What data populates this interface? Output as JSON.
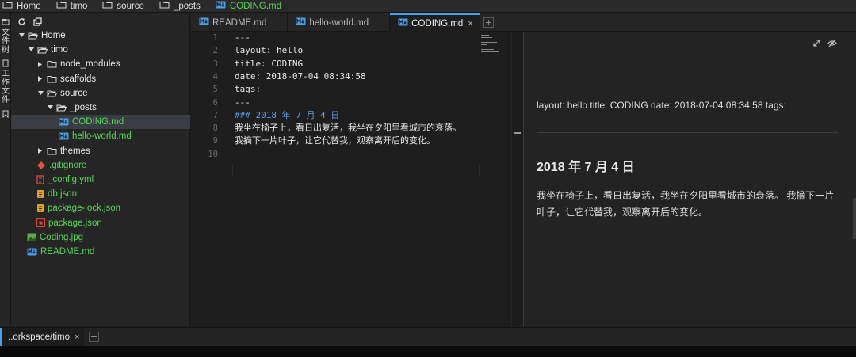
{
  "breadcrumb": [
    {
      "label": "Home",
      "icon": "folder-icon"
    },
    {
      "label": "timo",
      "icon": "folder-icon"
    },
    {
      "label": "source",
      "icon": "folder-icon"
    },
    {
      "label": "_posts",
      "icon": "folder-icon"
    },
    {
      "label": "CODING.md",
      "icon": "markdown-file-icon",
      "active": true
    }
  ],
  "side_strip": {
    "files_label": "文件树",
    "workspace_label": "工作文件"
  },
  "tree": [
    {
      "label": "Home",
      "depth": 0,
      "type": "folder",
      "open": true
    },
    {
      "label": "timo",
      "depth": 1,
      "type": "folder",
      "open": true
    },
    {
      "label": "node_modules",
      "depth": 2,
      "type": "folder",
      "open": false
    },
    {
      "label": "scaffolds",
      "depth": 2,
      "type": "folder",
      "open": false
    },
    {
      "label": "source",
      "depth": 2,
      "type": "folder",
      "open": true
    },
    {
      "label": "_posts",
      "depth": 3,
      "type": "folder",
      "open": true
    },
    {
      "label": "CODING.md",
      "depth": 4,
      "type": "md",
      "selected": true,
      "green": true
    },
    {
      "label": "hello-world.md",
      "depth": 4,
      "type": "md",
      "green": true
    },
    {
      "label": "themes",
      "depth": 2,
      "type": "folder",
      "open": false
    },
    {
      "label": ".gitignore",
      "depth": 2,
      "type": "git",
      "green": true
    },
    {
      "label": "_config.yml",
      "depth": 2,
      "type": "yml",
      "green": true
    },
    {
      "label": "db.json",
      "depth": 2,
      "type": "json",
      "green": true
    },
    {
      "label": "package-lock.json",
      "depth": 2,
      "type": "json",
      "green": true
    },
    {
      "label": "package.json",
      "depth": 2,
      "type": "npm",
      "green": true
    },
    {
      "label": "Coding.jpg",
      "depth": 1,
      "type": "image",
      "green": true
    },
    {
      "label": "README.md",
      "depth": 1,
      "type": "md",
      "green": true
    }
  ],
  "tabs": [
    {
      "label": "README.md",
      "active": false
    },
    {
      "label": "hello-world.md",
      "active": false
    },
    {
      "label": "CODING.md",
      "active": true,
      "close": "×"
    }
  ],
  "code_lines": [
    {
      "n": "1",
      "text": "---",
      "kind": "plain"
    },
    {
      "n": "2",
      "text": "layout: hello",
      "kind": "plain"
    },
    {
      "n": "3",
      "text": "title: CODING",
      "kind": "plain"
    },
    {
      "n": "4",
      "text": "date: 2018-07-04 08:34:58",
      "kind": "plain"
    },
    {
      "n": "5",
      "text": "tags:",
      "kind": "plain"
    },
    {
      "n": "6",
      "text": "---",
      "kind": "plain"
    },
    {
      "n": "7",
      "text": "### 2018 年 7 月 4 日",
      "kind": "heading"
    },
    {
      "n": "8",
      "text": "我坐在椅子上，看日出复活，我坐在夕阳里看城市的衰落。",
      "kind": "cjk"
    },
    {
      "n": "9",
      "text": "我摘下一片叶子，让它代替我，观察离开后的变化。",
      "kind": "cjk"
    },
    {
      "n": "10",
      "text": "",
      "kind": "plain"
    }
  ],
  "preview": {
    "front_matter": "layout: hello title: CODING date: 2018-07-04 08:34:58 tags:",
    "heading": "2018 年 7 月 4 日",
    "paragraph": "我坐在椅子上，看日出复活，我坐在夕阳里看城市的衰落。 我摘下一片叶子，让它代替我，观察离开后的变化。"
  },
  "bottom": {
    "workspace_tab": "..orkspace/timo",
    "close": "×"
  },
  "colors": {
    "accent": "#4a9fe8",
    "git_green": "#57d657",
    "heading_blue": "#5d9de8"
  }
}
